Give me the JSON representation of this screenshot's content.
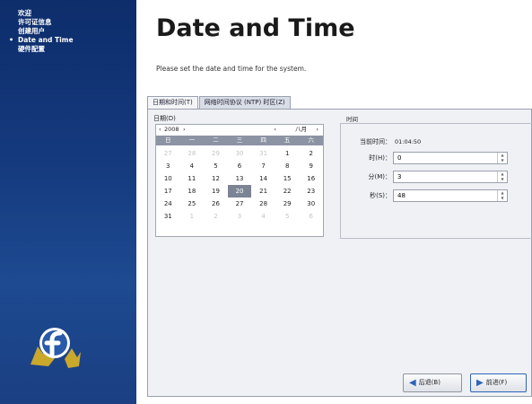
{
  "sidebar": {
    "items": [
      {
        "label": "欢迎"
      },
      {
        "label": "许可证信息"
      },
      {
        "label": "创建用户"
      },
      {
        "label": "Date and Time",
        "current": true
      },
      {
        "label": "硬件配置"
      }
    ],
    "logo": "fedora-logo"
  },
  "main": {
    "title": "Date and Time",
    "subtitle": "Please set the date and time for the system.",
    "tabs": [
      {
        "label": "日期和时间(T)",
        "active": true
      },
      {
        "label": "网络时间协议 (NTP) 时区(Z)"
      }
    ]
  },
  "date_section": {
    "label": "日期(D)",
    "calendar": {
      "year": "2008",
      "month": "八月",
      "prev_year": "‹",
      "next_year": "›",
      "prev_month": "‹",
      "next_month": "›",
      "weekdays": [
        "日",
        "一",
        "二",
        "三",
        "四",
        "五",
        "六"
      ],
      "weeks": [
        [
          "27",
          "28",
          "29",
          "30",
          "31",
          "1",
          "2"
        ],
        [
          "3",
          "4",
          "5",
          "6",
          "7",
          "8",
          "9"
        ],
        [
          "10",
          "11",
          "12",
          "13",
          "14",
          "15",
          "16"
        ],
        [
          "17",
          "18",
          "19",
          "20",
          "21",
          "22",
          "23"
        ],
        [
          "24",
          "25",
          "26",
          "27",
          "28",
          "29",
          "30"
        ],
        [
          "31",
          "1",
          "2",
          "3",
          "4",
          "5",
          "6"
        ]
      ],
      "selected_day": "20"
    }
  },
  "time_section": {
    "title": "时间",
    "current_time_label": "当前时间：",
    "current_time_value": "01:04:50",
    "hour_label": "时(H)：",
    "hour_value": "0",
    "minute_label": "分(M)：",
    "minute_value": "3",
    "second_label": "秒(S)：",
    "second_value": "48"
  },
  "buttons": {
    "back_label": "后退(B)",
    "next_label": "前进(F)"
  },
  "colors": {
    "sidebar": "#153a7e",
    "accent": "#2d63b9"
  }
}
